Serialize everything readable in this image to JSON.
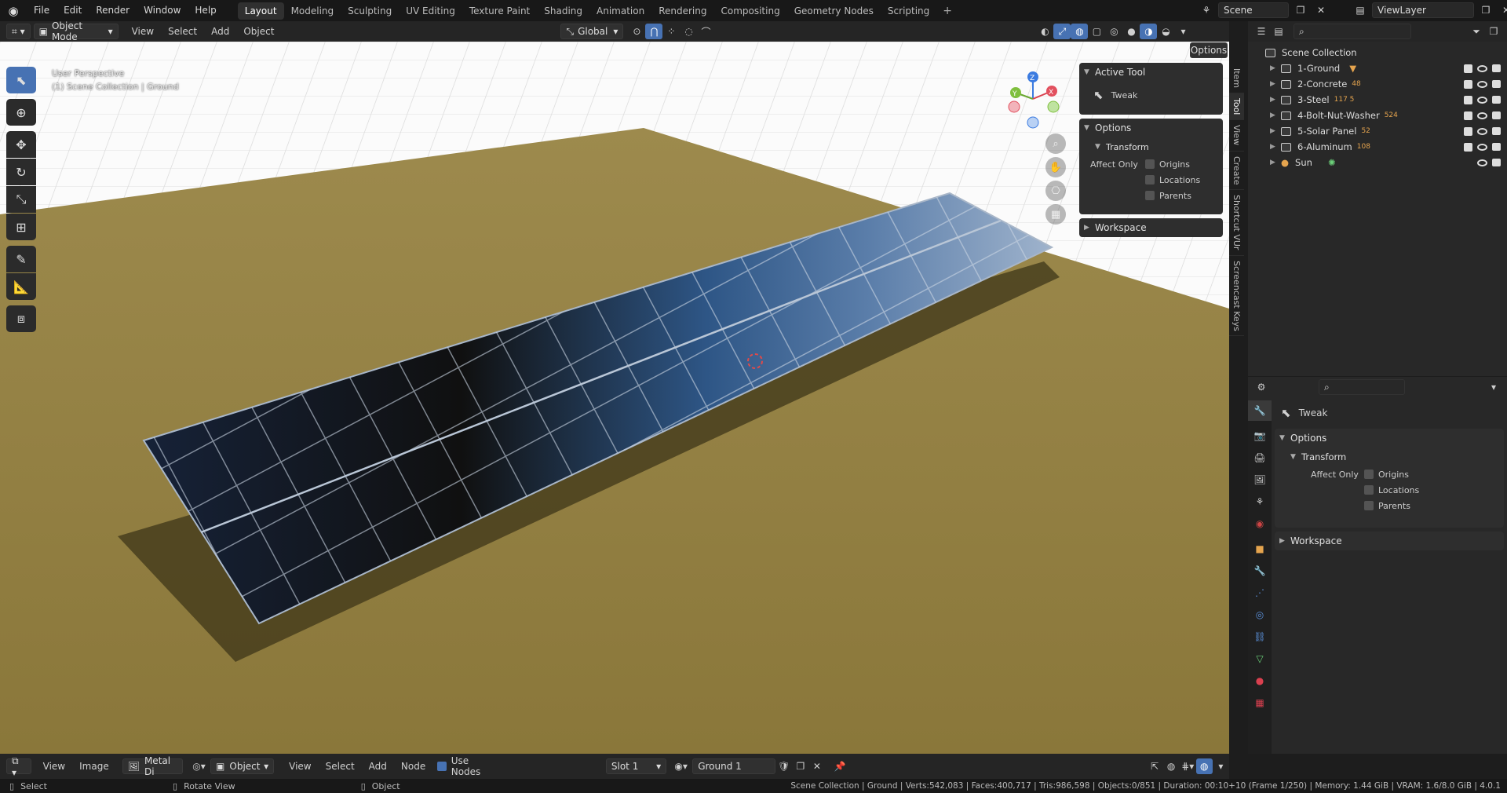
{
  "topbar": {
    "menus": [
      "File",
      "Edit",
      "Render",
      "Window",
      "Help"
    ],
    "workspaces": [
      "Layout",
      "Modeling",
      "Sculpting",
      "UV Editing",
      "Texture Paint",
      "Shading",
      "Animation",
      "Rendering",
      "Compositing",
      "Geometry Nodes",
      "Scripting"
    ],
    "active_workspace": "Layout",
    "add_workspace": "+",
    "scene": "Scene",
    "view_layer": "ViewLayer"
  },
  "viewport_header": {
    "mode": "Object Mode",
    "menus": [
      "View",
      "Select",
      "Add",
      "Object"
    ],
    "orientation": "Global",
    "options_label": "Options"
  },
  "viewport": {
    "perspective": "User Perspective",
    "collection_path": "(1) Scene Collection | Ground",
    "gizmo": {
      "z": "Z",
      "y": "Y",
      "x": "X"
    }
  },
  "side_tabs": [
    "Item",
    "Tool",
    "View",
    "Create",
    "Shortcut VUr",
    "Screencast Keys"
  ],
  "npanel": {
    "active_tool_title": "Active Tool",
    "tool_name": "Tweak",
    "options_title": "Options",
    "transform_title": "Transform",
    "affect_only": "Affect Only",
    "origins": "Origins",
    "locations": "Locations",
    "parents": "Parents",
    "workspace_title": "Workspace"
  },
  "outliner": {
    "root": "Scene Collection",
    "items": [
      {
        "name": "1-Ground",
        "badge": ""
      },
      {
        "name": "2-Concrete",
        "badge": "48"
      },
      {
        "name": "3-Steel",
        "badge": "117 5"
      },
      {
        "name": "4-Bolt-Nut-Washer",
        "badge": "524"
      },
      {
        "name": "5-Solar Panel",
        "badge": "52"
      },
      {
        "name": "6-Aluminum",
        "badge": "108"
      },
      {
        "name": "Sun",
        "badge": ""
      }
    ]
  },
  "properties": {
    "tool_name": "Tweak",
    "options_title": "Options",
    "transform_title": "Transform",
    "affect_only": "Affect Only",
    "origins": "Origins",
    "locations": "Locations",
    "parents": "Parents",
    "workspace_title": "Workspace"
  },
  "shader_header": {
    "menus1": [
      "View",
      "Image"
    ],
    "material_short": "Metal Di",
    "object_mode": "Object",
    "menus2": [
      "View",
      "Select",
      "Add",
      "Node"
    ],
    "use_nodes": "Use Nodes",
    "slot": "Slot 1",
    "material": "Ground 1"
  },
  "statusbar": {
    "select": "Select",
    "rotate": "Rotate View",
    "object": "Object",
    "stats": "Scene Collection | Ground | Verts:542,083 | Faces:400,717 | Tris:986,598 | Objects:0/851 | Duration: 00:10+10 (Frame 1/250) | Memory: 1.44 GiB | VRAM: 1.6/8.0 GiB | 4.0.1"
  },
  "colors": {
    "accent": "#4772b3",
    "ground": "#8d7a3c",
    "panel": "#2e2e2e"
  }
}
